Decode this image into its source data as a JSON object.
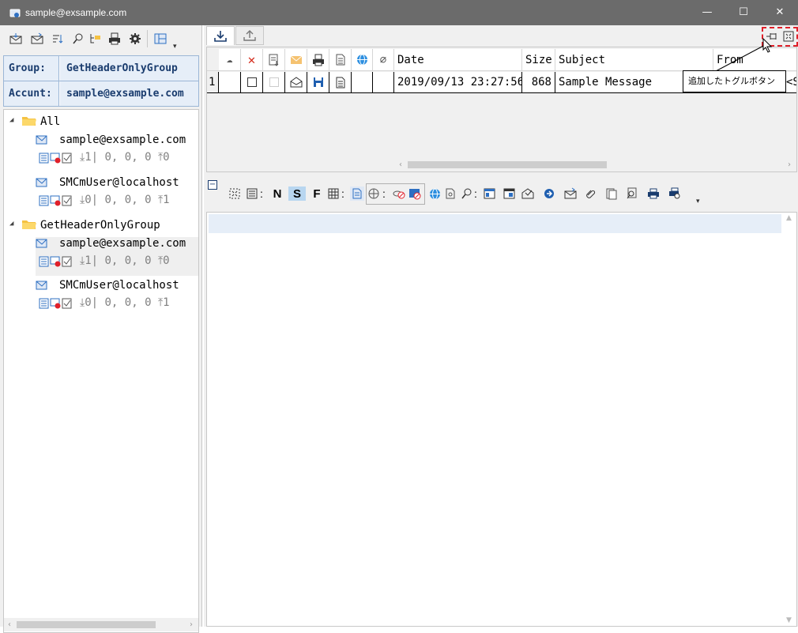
{
  "window": {
    "title": "sample@exsample.com",
    "minimize_glyph": "—",
    "maximize_glyph": "☐",
    "close_glyph": "✕"
  },
  "left_toolbar": {
    "icons": [
      "receive-mail-icon",
      "send-mail-icon",
      "sort-icon",
      "search-icon",
      "folder-icon",
      "printer-icon",
      "gear-icon",
      "layout-icon"
    ],
    "overflow_glyph": "▾"
  },
  "info": {
    "group_label": "Group:",
    "group_value": "GetHeaderOnlyGroup",
    "account_label": "Accunt:",
    "account_value": "sample@exsample.com"
  },
  "tree": {
    "groups": [
      {
        "name": "All",
        "accounts": [
          {
            "name": "sample@exsample.com",
            "download": "1",
            "counts": "| 0, 0, 0",
            "upload": "0"
          },
          {
            "name": "SMCmUser@localhost",
            "download": "0",
            "counts": "| 0, 0, 0",
            "upload": "1"
          }
        ]
      },
      {
        "name": "GetHeaderOnlyGroup",
        "accounts": [
          {
            "name": "sample@exsample.com",
            "download": "1",
            "counts": "| 0, 0, 0",
            "upload": "0"
          },
          {
            "name": "SMCmUser@localhost",
            "download": "0",
            "counts": "| 0, 0, 0",
            "upload": "1"
          }
        ]
      }
    ]
  },
  "grid": {
    "columns": {
      "date": "Date",
      "size": "Size",
      "subject": "Subject",
      "from": "From"
    },
    "rows": [
      {
        "index": "1",
        "date": "2019/09/13 23:27:56",
        "size": "868",
        "subject": "Sample Message",
        "from": "<S"
      }
    ]
  },
  "tooltip": {
    "text": "追加したトグルボタン"
  },
  "viewer_toolbar": {
    "collapse_glyph": "−",
    "n_label": "N",
    "s_label": "S",
    "f_label": "F",
    "colon": ":"
  },
  "colors": {
    "titlebar": "#6b6b6b",
    "accent_blue": "#1a3c6e",
    "highlight": "#e6eef8",
    "dashed_red": "#e0202a"
  }
}
